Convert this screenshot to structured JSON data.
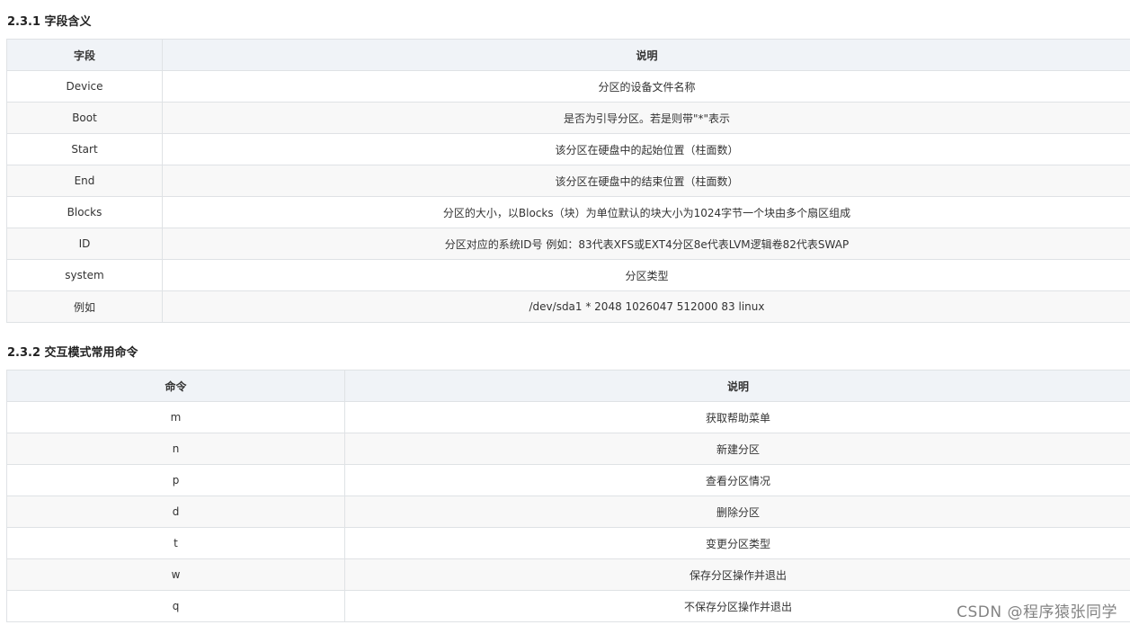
{
  "section1": {
    "title": "2.3.1 字段含义",
    "headers": [
      "字段",
      "说明"
    ],
    "rows": [
      [
        "Device",
        "分区的设备文件名称"
      ],
      [
        "Boot",
        "是否为引导分区。若是则带\"*\"表示"
      ],
      [
        "Start",
        "该分区在硬盘中的起始位置（柱面数）"
      ],
      [
        "End",
        "该分区在硬盘中的结束位置（柱面数）"
      ],
      [
        "Blocks",
        "分区的大小，以Blocks（块）为单位默认的块大小为1024字节一个块由多个扇区组成"
      ],
      [
        "ID",
        "分区对应的系统ID号 例如：83代表XFS或EXT4分区8e代表LVM逻辑卷82代表SWAP"
      ],
      [
        "system",
        "分区类型"
      ],
      [
        "例如",
        "/dev/sda1 * 2048 1026047 512000 83 linux"
      ]
    ]
  },
  "section2": {
    "title": "2.3.2 交互模式常用命令",
    "headers": [
      "命令",
      "说明"
    ],
    "rows": [
      [
        "m",
        "获取帮助菜单"
      ],
      [
        "n",
        "新建分区"
      ],
      [
        "p",
        "查看分区情况"
      ],
      [
        "d",
        "删除分区"
      ],
      [
        "t",
        "变更分区类型"
      ],
      [
        "w",
        "保存分区操作并退出"
      ],
      [
        "q",
        "不保存分区操作并退出"
      ]
    ]
  },
  "watermark": "CSDN @程序猿张同学"
}
